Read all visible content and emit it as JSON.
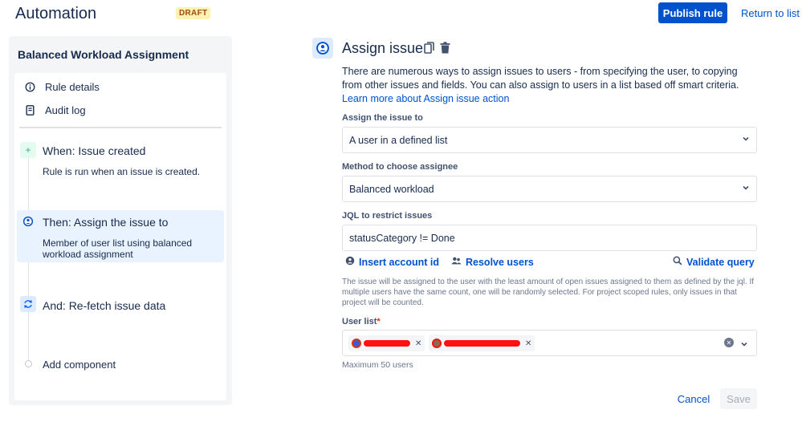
{
  "header": {
    "title": "Automation",
    "status_badge": "DRAFT",
    "publish_label": "Publish rule",
    "return_label": "Return to list"
  },
  "sidebar": {
    "rule_name": "Balanced Workload Assignment",
    "nav": [
      {
        "label": "Rule details",
        "icon": "info-icon"
      },
      {
        "label": "Audit log",
        "icon": "document-icon"
      }
    ],
    "components": [
      {
        "title": "When: Issue created",
        "description": "Rule is run when an issue is created.",
        "icon": "plus-icon",
        "color": "#36b37e"
      },
      {
        "title": "Then: Assign the issue to",
        "description": "Member of user list using balanced workload assignment",
        "icon": "user-circle-icon",
        "color": "#0052cc",
        "selected": true
      },
      {
        "title": "And: Re-fetch issue data",
        "description": "",
        "icon": "refresh-icon",
        "color": "#0065ff"
      }
    ],
    "add_component_label": "Add component"
  },
  "main": {
    "title": "Assign issue",
    "description": "There are numerous ways to assign issues to users - from specifying the user, to copying from other issues and fields. You can also assign to users in a list based off smart criteria.",
    "learn_more": "Learn more about Assign issue action",
    "assign_to": {
      "label": "Assign the issue to",
      "value": "A user in a defined list"
    },
    "method": {
      "label": "Method to choose assignee",
      "value": "Balanced workload"
    },
    "jql": {
      "label": "JQL to restrict issues",
      "value": "statusCategory != Done"
    },
    "actions": {
      "insert_account_id": "Insert account id",
      "resolve_users": "Resolve users",
      "validate_query": "Validate query"
    },
    "help_text": "The issue will be assigned to the user with the least amount of open issues assigned to them as defined by the jql. If multiple users have the same count, one will be randomly selected. For project scoped rules, only issues in that project will be counted.",
    "user_list": {
      "label": "User list",
      "required_mark": "*",
      "max_note": "Maximum 50 users"
    },
    "cancel_label": "Cancel",
    "save_label": "Save"
  },
  "colors": {
    "primary": "#0052cc",
    "text": "#172b4d",
    "subtle": "#6b778c",
    "draft_bg": "#fff0b3",
    "selected_bg": "#e9f2ff"
  }
}
